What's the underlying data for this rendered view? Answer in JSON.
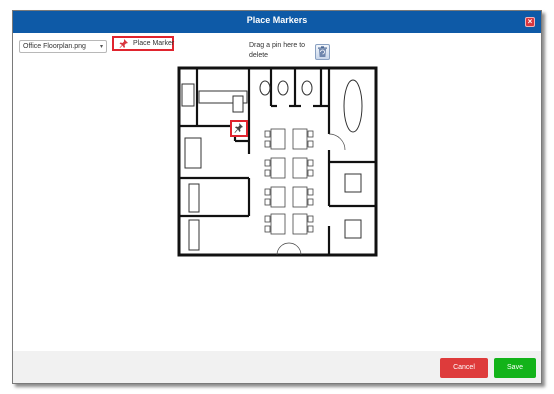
{
  "dialog": {
    "title": "Place Markers",
    "close_label": "×"
  },
  "toolbar": {
    "file_select": {
      "value": "Office Floorplan.png",
      "caret": "▾"
    },
    "place_marker_label": "Place Marker",
    "delete_hint": "Drag a pin here to delete"
  },
  "footer": {
    "cancel_label": "Cancel",
    "save_label": "Save"
  },
  "colors": {
    "titlebar": "#0e5aa7",
    "highlight": "#e0242e",
    "cancel": "#de3b3b",
    "save": "#13b319",
    "footer": "#f1f1f1"
  },
  "icons": {
    "close": "close-icon",
    "pin": "pushpin-icon",
    "trash": "trash-icon",
    "marker": "location-pin-icon"
  }
}
